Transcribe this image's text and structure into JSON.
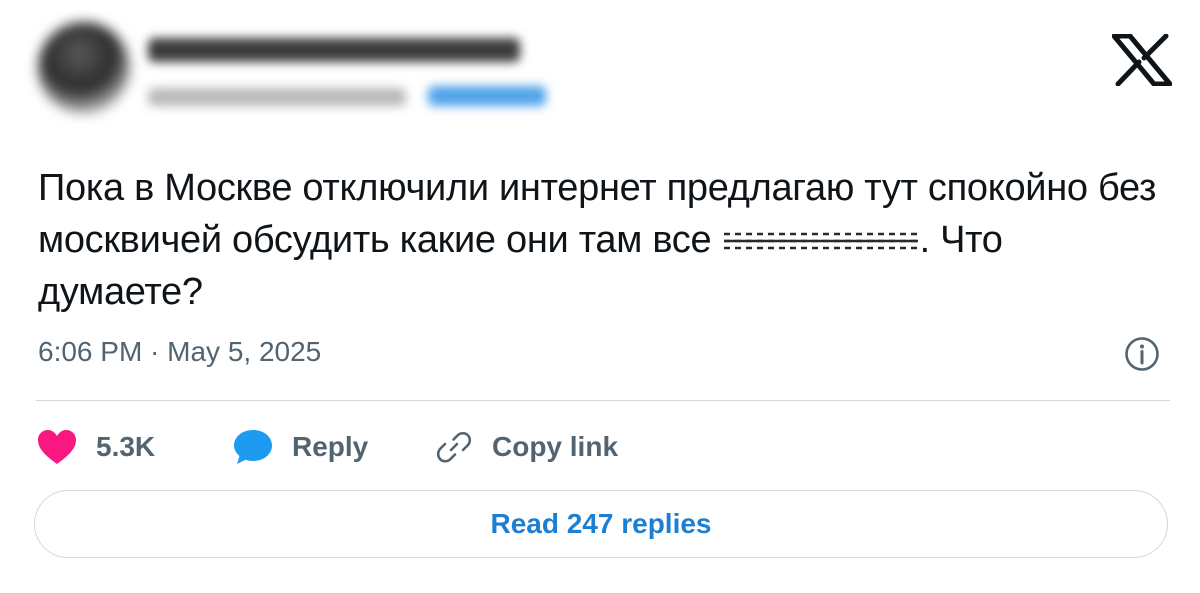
{
  "author": {
    "name": "Наталья Переверзенцева",
    "handle": "@nperevertsenceva",
    "follow_label": "Follow"
  },
  "platform_icon": "x-logo-icon",
  "tweet": {
    "text_part1": "Пока в Москве отключили интернет предлагаю тут спокойно без москвичей обсудить какие они там все",
    "censored_icon": "censored-word",
    "text_part2": ". Что думаете?",
    "timestamp": "6:06 PM · May 5, 2025"
  },
  "actions": {
    "like_count": "5.3K",
    "reply_label": "Reply",
    "copy_label": "Copy link",
    "read_replies_label": "Read 247 replies"
  },
  "colors": {
    "like": "#f91880",
    "reply": "#1d9bf0",
    "link_text": "#1d7fd1",
    "muted": "#536471",
    "divider": "#cfd9de"
  }
}
